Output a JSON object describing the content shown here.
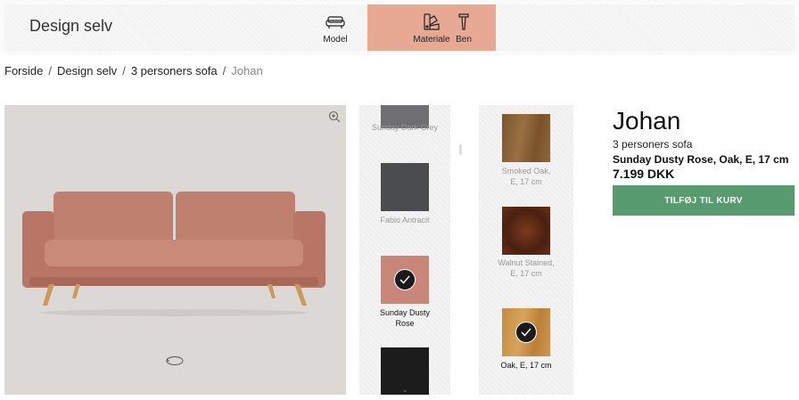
{
  "header": {
    "brand": "Design selv",
    "steps": [
      {
        "label": "Model",
        "icon": "sofa-icon"
      },
      {
        "label": "Materiale",
        "icon": "palette-icon"
      },
      {
        "label": "Ben",
        "icon": "leg-icon"
      }
    ],
    "active_color": "#e8a994"
  },
  "breadcrumb": {
    "items": [
      "Forside",
      "Design selv",
      "3 personers sofa"
    ],
    "current": "Johan",
    "separator": "/"
  },
  "fabrics": [
    {
      "label": "Sunday Dark Grey",
      "color": "#6f6e70",
      "selected": false
    },
    {
      "label": "Fabio Antracit",
      "color": "#4b4c4d",
      "selected": false
    },
    {
      "label": "Sunday Dusty Rose",
      "color": "#c9877a",
      "selected": true
    },
    {
      "label": "",
      "color": "#1c1c1c",
      "selected": false
    }
  ],
  "woods": [
    {
      "label": "Smoked Oak, E, 17 cm",
      "color": "#8a6236",
      "selected": false
    },
    {
      "label": "Walnut Stained, E, 17 cm",
      "color": "#5a2a16",
      "selected": false
    },
    {
      "label": "Oak, E, 17 cm",
      "color": "#c48b43",
      "selected": true
    }
  ],
  "product": {
    "name": "Johan",
    "type": "3 personers sofa",
    "config": "Sunday Dusty Rose,  Oak, E, 17 cm",
    "price": "7.199 DKK",
    "cart_label": "TILFØJ TIL KURV",
    "cart_color": "#579b6f"
  }
}
